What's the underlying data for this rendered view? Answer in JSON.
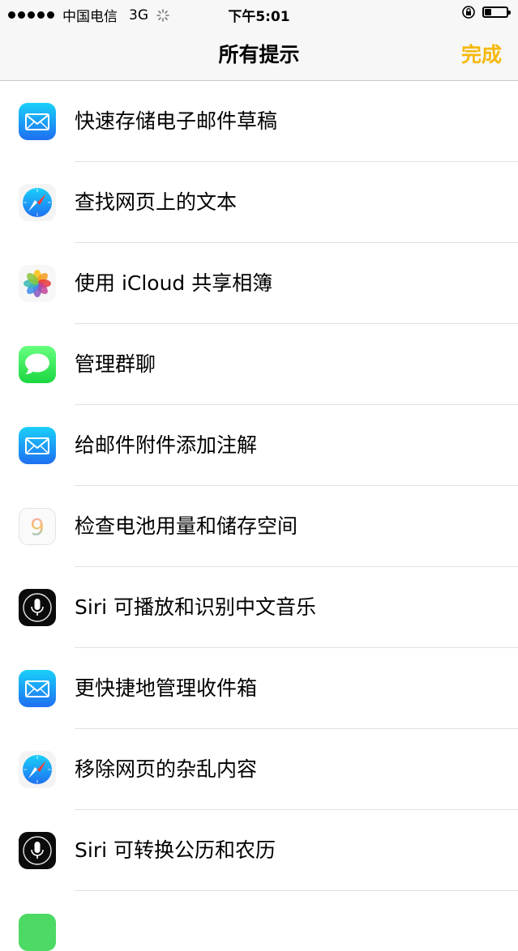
{
  "status": {
    "carrier": "中国电信",
    "network": "3G",
    "time": "下午5:01",
    "battery_level": 0.3
  },
  "nav": {
    "title": "所有提示",
    "done": "完成"
  },
  "tips": [
    {
      "label": "快速存储电子邮件草稿",
      "icon": "mail-icon"
    },
    {
      "label": "查找网页上的文本",
      "icon": "safari-icon"
    },
    {
      "label": "使用 iCloud 共享相簿",
      "icon": "photos-icon"
    },
    {
      "label": "管理群聊",
      "icon": "messages-icon"
    },
    {
      "label": "给邮件附件添加注解",
      "icon": "mail-icon"
    },
    {
      "label": "检查电池用量和储存空间",
      "icon": "ios9-icon"
    },
    {
      "label": "Siri 可播放和识别中文音乐",
      "icon": "siri-icon"
    },
    {
      "label": "更快捷地管理收件箱",
      "icon": "mail-icon"
    },
    {
      "label": "移除网页的杂乱内容",
      "icon": "safari-icon"
    },
    {
      "label": "Siri 可转换公历和农历",
      "icon": "siri-icon"
    }
  ],
  "colors": {
    "accent": "#f5b90c",
    "mail": "#1e8cf5",
    "messages": "#4cd964"
  }
}
